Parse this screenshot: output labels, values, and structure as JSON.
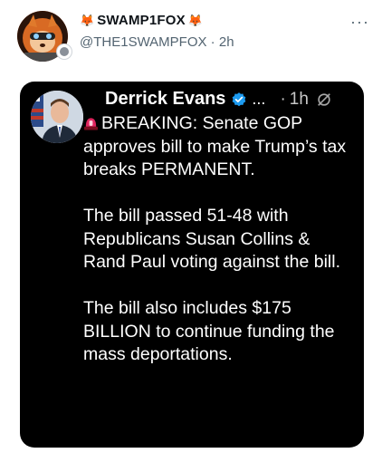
{
  "post": {
    "display_name": "SWAMP1FOX",
    "name_emoji_left": "🦊",
    "name_emoji_right": "🦊",
    "handle": "@THE1SWAMPFOX",
    "time_separator": " · ",
    "time": "2h",
    "more_label": "···"
  },
  "quoted": {
    "name": "Derrick Evans",
    "ellipsis": "...",
    "time": "1h",
    "line1": "BREAKING: Senate GOP approves bill to make Trump’s tax breaks PERMANENT.",
    "para2": "The bill passed 51-48 with Republicans Susan Collins & Rand Paul voting against the bill.",
    "para3": "The bill also includes $175 BILLION to continue funding the mass deportations."
  },
  "colors": {
    "accent_blue": "#1d9bf0",
    "embed_bg": "#000000",
    "handle_gray": "#536471",
    "siren_red": "#e0245e"
  },
  "icons": {
    "siren": "siren-icon",
    "verified": "verified-check-icon",
    "more": "more-dots-icon"
  }
}
